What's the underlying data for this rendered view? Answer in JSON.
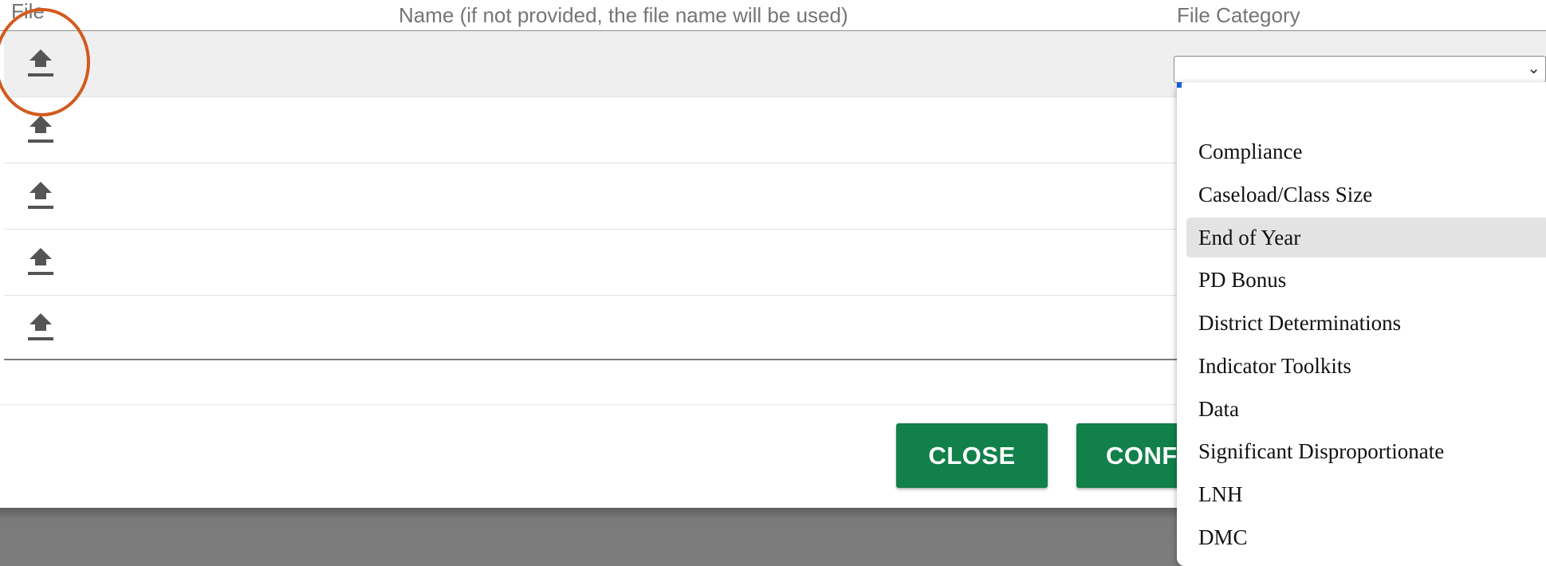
{
  "table": {
    "col_file": "File",
    "col_name": "Name (if not provided, the file name will be used)",
    "col_category": "File Category",
    "rows": [
      {
        "upload_icon": "upload-icon"
      },
      {
        "upload_icon": "upload-icon"
      },
      {
        "upload_icon": "upload-icon"
      },
      {
        "upload_icon": "upload-icon"
      },
      {
        "upload_icon": "upload-icon"
      }
    ]
  },
  "category_select": {
    "selected": ""
  },
  "dropdown": {
    "options": [
      "",
      "Compliance",
      "Caseload/Class Size",
      "End of Year",
      "PD Bonus",
      "District Determinations",
      "Indicator Toolkits",
      "Data",
      "Significant Disproportionate",
      "LNH",
      "DMC"
    ],
    "highlighted": "End of Year"
  },
  "buttons": {
    "close": "CLOSE",
    "confirm": "CONFI"
  },
  "colors": {
    "button": "#11804a",
    "annotation_circle": "#d35a1f",
    "active_row": "#efefef"
  }
}
